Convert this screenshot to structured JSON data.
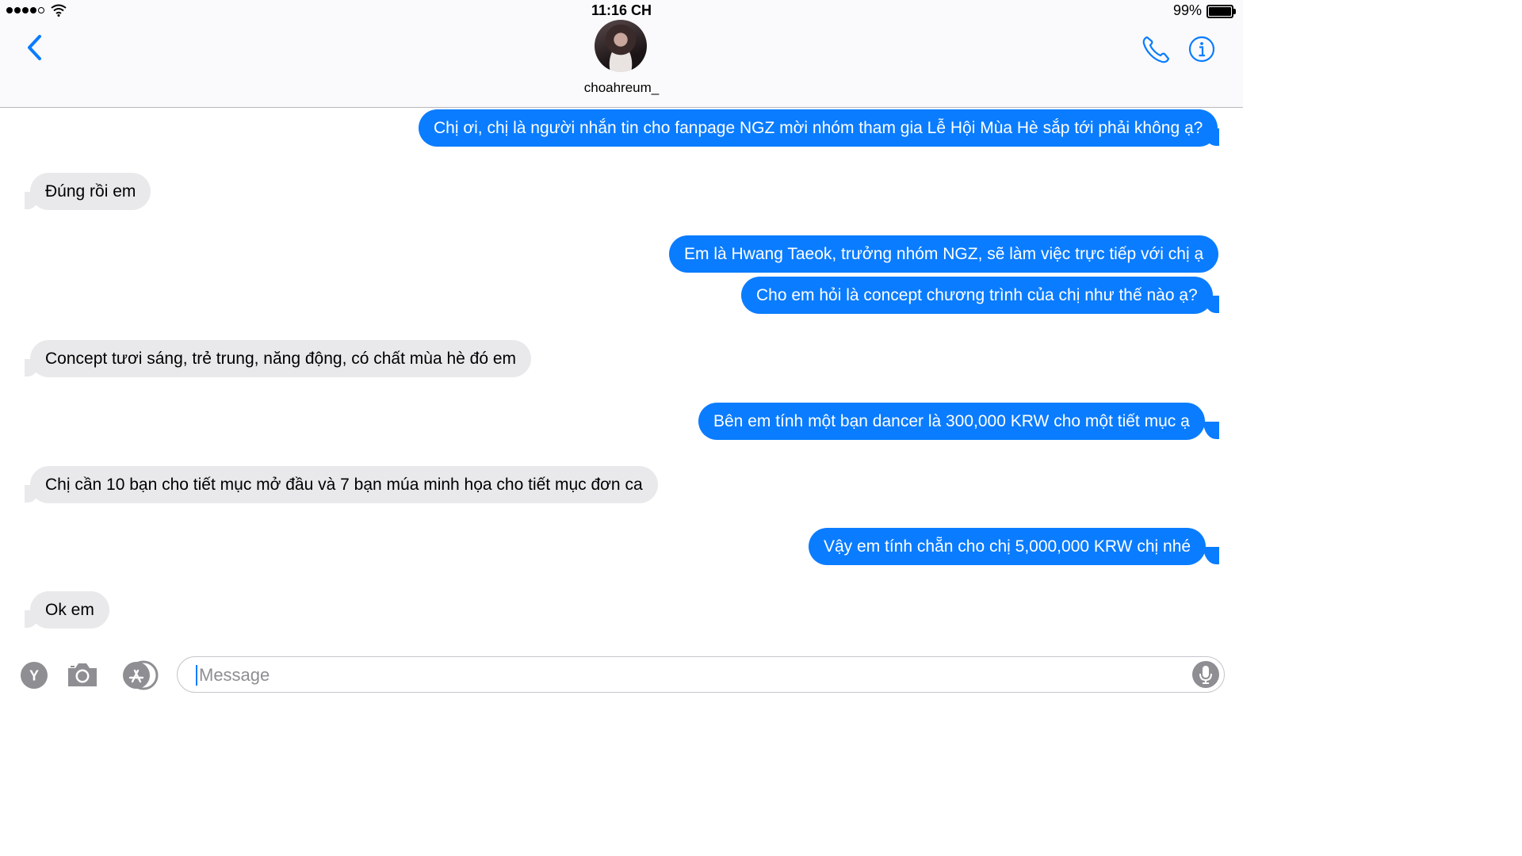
{
  "status_bar": {
    "time": "11:16 CH",
    "battery_percent": "99%",
    "battery_level": 0.99,
    "signal_bars_filled": 4,
    "signal_bars_total": 5
  },
  "header": {
    "contact_name": "choahreum_"
  },
  "messages": [
    {
      "direction": "out",
      "text": "Chị ơi, chị là người nhắn tin cho fanpage NGZ mời nhóm tham gia Lễ Hội Mùa Hè sắp tới phải không ạ?"
    },
    {
      "direction": "in",
      "text": "Đúng rồi em"
    },
    {
      "direction": "out",
      "text": "Em là Hwang Taeok, trưởng nhóm NGZ, sẽ làm việc trực tiếp với chị ạ"
    },
    {
      "direction": "out",
      "text": "Cho em hỏi là concept chương trình của chị như thế nào ạ?"
    },
    {
      "direction": "in",
      "text": "Concept tươi sáng, trẻ trung, năng động, có chất mùa hè đó em"
    },
    {
      "direction": "out",
      "text": "Bên em tính một bạn dancer là 300,000 KRW cho một tiết mục ạ"
    },
    {
      "direction": "in",
      "text": "Chị cần 10 bạn cho tiết mục mở đầu và 7 bạn múa minh họa cho tiết mục đơn ca"
    },
    {
      "direction": "out",
      "text": "Vậy em tính chẵn cho chị 5,000,000 KRW chị nhé"
    },
    {
      "direction": "in",
      "text": "Ok em"
    }
  ],
  "input": {
    "placeholder": "Message",
    "value": ""
  },
  "colors": {
    "outgoing_bubble": "#0a7cff",
    "incoming_bubble": "#e9e9eb",
    "accent": "#0a7cff"
  },
  "icons": {
    "back": "chevron-left-icon",
    "call": "phone-icon",
    "info": "info-icon",
    "app1": "y-app-icon",
    "camera": "camera-icon",
    "app_store": "app-store-icon",
    "mic": "microphone-icon"
  }
}
